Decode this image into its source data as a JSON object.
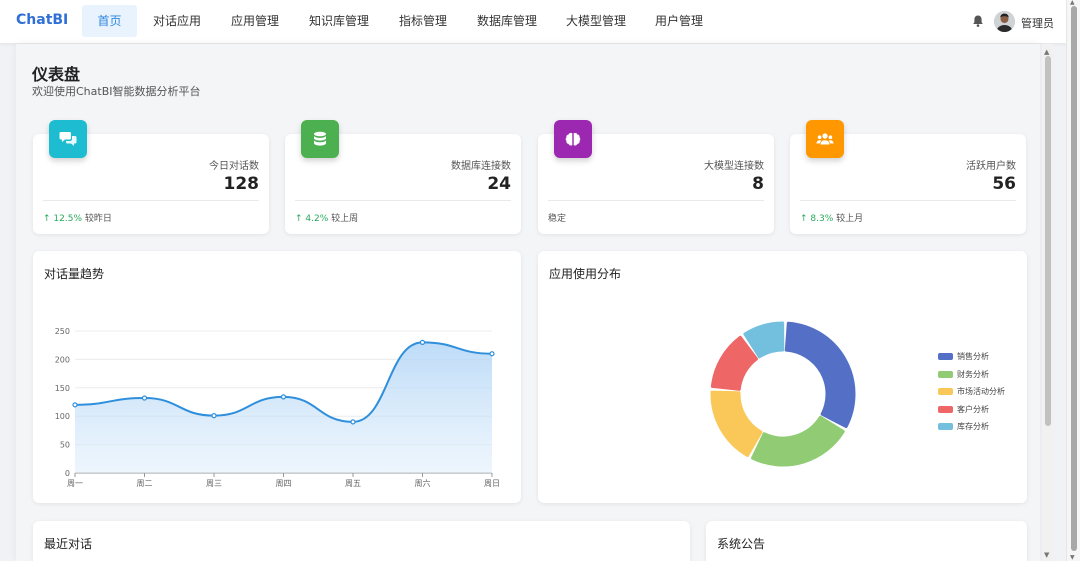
{
  "nav": {
    "brand": "ChatBI",
    "items": [
      "首页",
      "对话应用",
      "应用管理",
      "知识库管理",
      "指标管理",
      "数据库管理",
      "大模型管理",
      "用户管理"
    ],
    "user": "管理员"
  },
  "page": {
    "title": "仪表盘",
    "subtitle": "欢迎使用ChatBI智能数据分析平台"
  },
  "stats": [
    {
      "label": "今日对话数",
      "value": "128",
      "trend": "12.5%",
      "note": "较昨日",
      "color": "#1ebcd0",
      "icon": "comments-icon"
    },
    {
      "label": "数据库连接数",
      "value": "24",
      "trend": "4.2%",
      "note": "较上周",
      "color": "#4caf50",
      "icon": "database-icon"
    },
    {
      "label": "大模型连接数",
      "value": "8",
      "trend": "",
      "note": "稳定",
      "color": "#9c27b0",
      "icon": "brain-icon"
    },
    {
      "label": "活跃用户数",
      "value": "56",
      "trend": "8.3%",
      "note": "较上月",
      "color": "#ff9800",
      "icon": "users-icon"
    }
  ],
  "trend_chart": {
    "title": "对话量趋势"
  },
  "pie_chart": {
    "title": "应用使用分布"
  },
  "recent": {
    "title": "最近对话"
  },
  "notice": {
    "title": "系统公告"
  },
  "chart_data": [
    {
      "type": "line",
      "title": "对话量趋势",
      "categories": [
        "周一",
        "周二",
        "周三",
        "周四",
        "周五",
        "周六",
        "周日"
      ],
      "series": [
        {
          "values": [
            120,
            132,
            101,
            134,
            90,
            230,
            210
          ],
          "color": "#2f8fdc"
        }
      ],
      "yticks": [
        0,
        50,
        100,
        150,
        200,
        250
      ],
      "ylim": [
        0,
        250
      ],
      "smooth": true,
      "area": true,
      "grid": true
    },
    {
      "type": "pie",
      "title": "应用使用分布",
      "donut": true,
      "legend_position": "right",
      "slices": [
        {
          "name": "销售分析",
          "value": 32,
          "color": "#5470c6"
        },
        {
          "name": "财务分析",
          "value": 24,
          "color": "#91cc75"
        },
        {
          "name": "市场活动分析",
          "value": 18,
          "color": "#fac858"
        },
        {
          "name": "客户分析",
          "value": 14,
          "color": "#ee6666"
        },
        {
          "name": "库存分析",
          "value": 10,
          "color": "#73c0de"
        }
      ]
    }
  ]
}
